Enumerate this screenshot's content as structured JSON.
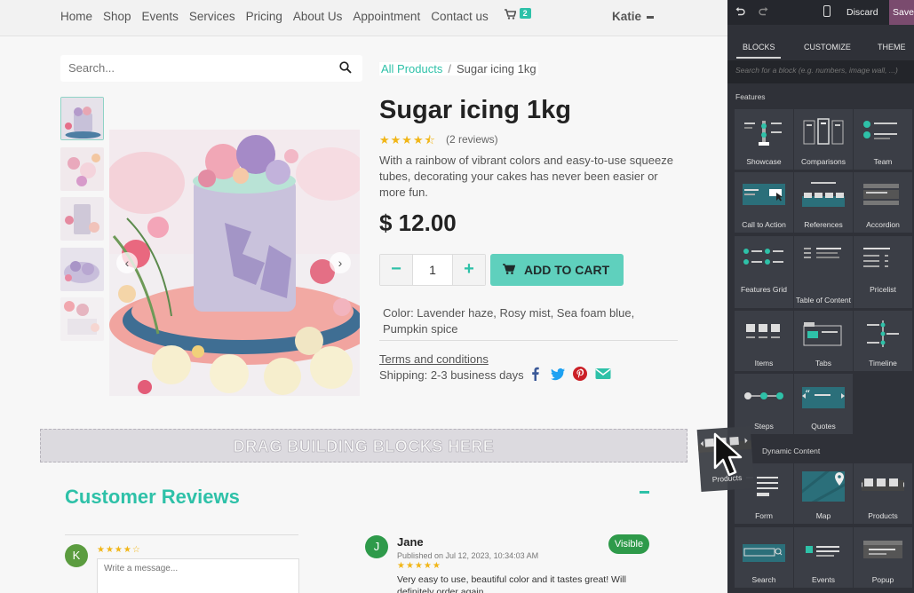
{
  "nav": {
    "items": [
      "Home",
      "Shop",
      "Events",
      "Services",
      "Pricing",
      "About Us",
      "Appointment",
      "Contact us"
    ],
    "cart_count": "2",
    "user": "Katie"
  },
  "search": {
    "placeholder": "Search..."
  },
  "breadcrumb": {
    "link": "All Products",
    "sep": "/",
    "current": "Sugar icing 1kg"
  },
  "product": {
    "title": "Sugar icing 1kg",
    "stars": "★★★★⯪",
    "reviews_count": "(2 reviews)",
    "rating": 4.5,
    "description": "With a rainbow of vibrant colors and easy-to-use squeeze tubes, decorating your cakes has never been easier or more fun.",
    "price": "$ 12.00",
    "quantity": "1",
    "add_to_cart": "ADD TO CART",
    "color_line": "Color: Lavender haze, Rosy mist, Sea foam blue, Pumpkin spice",
    "terms": "Terms and conditions",
    "shipping": "Shipping: 2-3 business days",
    "social": [
      "facebook-icon",
      "twitter-icon",
      "pinterest-icon",
      "email-icon"
    ]
  },
  "dropzone": {
    "label": "DRAG BUILDING BLOCKS HERE"
  },
  "reviews": {
    "title": "Customer Reviews",
    "input_initial": "K",
    "input_stars": "★★★★☆",
    "message_placeholder": "Write a message...",
    "entry": {
      "initial": "J",
      "name": "Jane",
      "date": "Published on Jul 12, 2023, 10:34:03 AM",
      "stars": "★★★★★",
      "text": "Very easy to use, beautiful color and it tastes great! Will definitely order again.",
      "badge": "Visible"
    }
  },
  "editor": {
    "discard": "Discard",
    "save": "Save",
    "tabs": [
      "BLOCKS",
      "CUSTOMIZE",
      "THEME"
    ],
    "search_placeholder": "Search for a block (e.g. numbers, image wall, ...)",
    "features_heading": "Features",
    "blocks": [
      "Showcase",
      "Comparisons",
      "Team",
      "Call to Action",
      "References",
      "Accordion",
      "Features Grid",
      "Table of Content",
      "Pricelist",
      "Items",
      "Tabs",
      "Timeline",
      "Steps",
      "Quotes"
    ],
    "dynamic_heading": "Dynamic Content",
    "dynamic_blocks": [
      "Form",
      "Map",
      "Products",
      "Search",
      "Events",
      "Popup"
    ],
    "dragged_block": "Products"
  },
  "colors": {
    "accent": "#2ec1a8",
    "panel": "#2f3138",
    "save": "#7a4b6e",
    "star": "#f1b617",
    "visible": "#2e9a4a"
  }
}
